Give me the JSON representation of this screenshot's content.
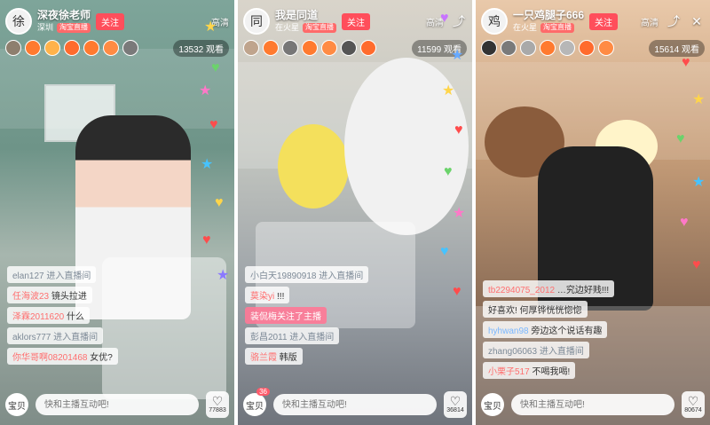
{
  "panels": [
    {
      "host": "深夜徐老师",
      "location": "深圳",
      "badge": "淘宝直播",
      "follow": "关注",
      "hd": "高清",
      "viewers": "13532 观看",
      "avatar_char": "徐",
      "chat": [
        {
          "user": "elan127",
          "text": "进入直播间",
          "type": "enter"
        },
        {
          "user": "任海波23",
          "text": "镜头拉进",
          "type": "normal"
        },
        {
          "user": "泽霖2011620",
          "text": "什么",
          "type": "normal"
        },
        {
          "user": "aklors777",
          "text": "进入直播间",
          "type": "enter"
        },
        {
          "user": "你华哥啊08201468",
          "text": "女优?",
          "type": "normal"
        }
      ],
      "bottom": {
        "baby": "宝贝",
        "placeholder": "快和主播互动吧!",
        "likes": "77883"
      }
    },
    {
      "host": "我是同道",
      "location": "在火星",
      "badge": "淘宝直播",
      "follow": "关注",
      "hd": "高清",
      "viewers": "11599 观看",
      "avatar_char": "同",
      "chat": [
        {
          "user": "小白天19890918",
          "text": "进入直播间",
          "type": "enter"
        },
        {
          "user": "莫染yi",
          "text": "!!!",
          "type": "normal"
        },
        {
          "user": "装侃梅关注了主播",
          "text": "",
          "type": "pink"
        },
        {
          "user": "彭昌2011",
          "text": "进入直播间",
          "type": "enter"
        },
        {
          "user": "骆兰霞",
          "text": "韩版",
          "type": "normal"
        }
      ],
      "bottom": {
        "baby": "宝贝",
        "baby_count": "36",
        "placeholder": "快和主播互动吧!",
        "likes": "36814"
      }
    },
    {
      "host": "一只鸡腿子666",
      "location": "在火星",
      "badge": "淘宝直播",
      "follow": "关注",
      "hd": "高清",
      "viewers": "15614 观看",
      "avatar_char": "鸡",
      "chat": [
        {
          "user": "tb2294075_2012",
          "text": "…究边好贱!!!",
          "type": "normal"
        },
        {
          "user": "",
          "text": "好喜欢! 何厚铧恍恍惚惚",
          "type": "plain"
        },
        {
          "user": "hyhwan98",
          "text": "旁边这个说话有趣",
          "type": "blue"
        },
        {
          "user": "zhang06063",
          "text": "进入直播间",
          "type": "enter"
        },
        {
          "user": "小栗子517",
          "text": "不喝我喝!",
          "type": "normal"
        }
      ],
      "bottom": {
        "baby": "宝贝",
        "placeholder": "快和主播互动吧!",
        "likes": "80674"
      }
    }
  ],
  "icons": {
    "share": "share-icon",
    "close": "close-icon",
    "heart": "heart-icon"
  }
}
